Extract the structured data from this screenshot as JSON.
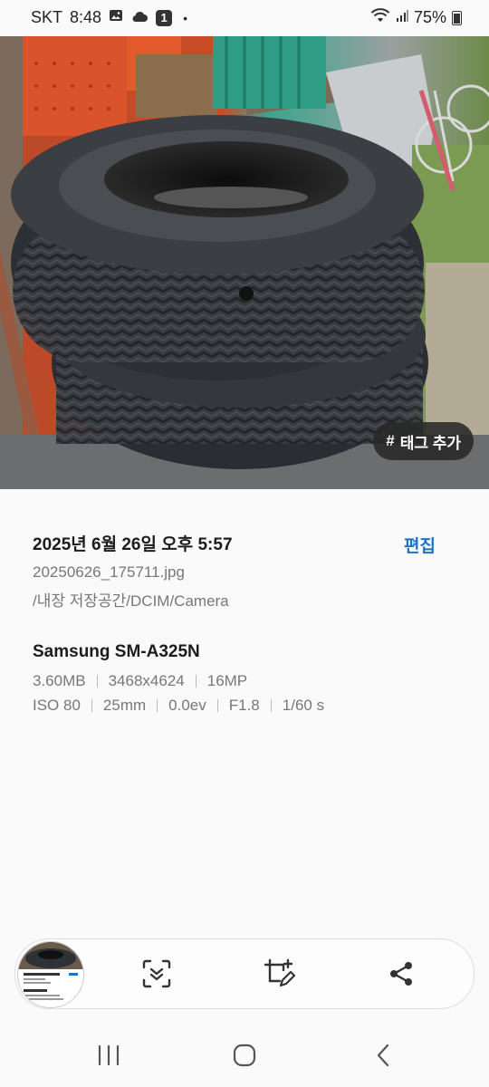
{
  "status": {
    "carrier": "SKT",
    "time": "8:48",
    "notif_count": "1",
    "dot": "•",
    "battery": "75%"
  },
  "photo": {
    "tag_label": "태그 추가",
    "tag_hash": "#"
  },
  "info": {
    "datetime": "2025년 6월 26일 오후 5:57",
    "edit_label": "편집",
    "filename": "20250626_175711.jpg",
    "path": "/내장 저장공간/DCIM/Camera",
    "model": "Samsung SM-A325N",
    "size": "3.60MB",
    "resolution": "3468x4624",
    "megapixels": "16MP",
    "iso": "ISO 80",
    "focal": "25mm",
    "ev": "0.0ev",
    "aperture": "F1.8",
    "shutter": "1/60 s"
  },
  "toolbar": {
    "icons": [
      "scan-icon",
      "crop-edit-icon",
      "share-icon"
    ]
  },
  "nav": {
    "icons": [
      "recents-icon",
      "home-icon",
      "back-icon"
    ]
  }
}
